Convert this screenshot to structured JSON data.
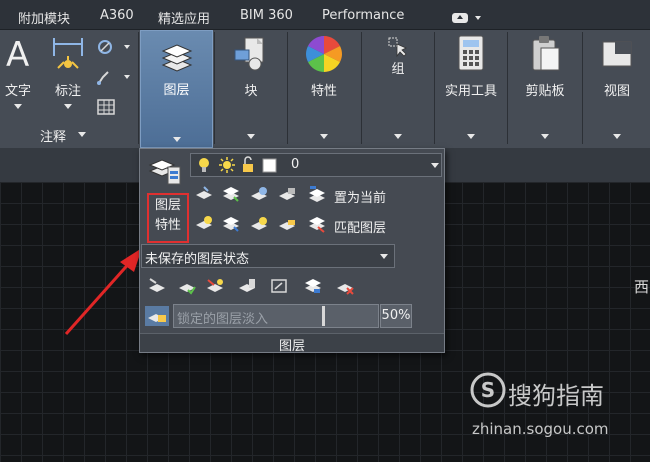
{
  "tabs": [
    "附加模块",
    "A360",
    "精选应用",
    "BIM 360",
    "Performance"
  ],
  "annotation_panel": {
    "text_label": "文字",
    "dim_label": "标注",
    "footer_label": "注释"
  },
  "ribbon_buttons": {
    "layers": "图层",
    "block": "块",
    "properties": "特性",
    "group": "组",
    "utilities": "实用工具",
    "clipboard": "剪贴板",
    "view": "视图"
  },
  "layer_flyout": {
    "current_layer": "0",
    "make_current": "置为当前",
    "match_layer": "匹配图层",
    "layer_props_line1": "图层",
    "layer_props_line2": "特性",
    "layer_state": "未保存的图层状态",
    "lock_fade_label": "锁定的图层淡入",
    "lock_fade_value": "50%",
    "footer_label": "图层"
  },
  "colors": {
    "accent_blue": "#5a7ba3",
    "highlight_red": "#e03030"
  },
  "watermark": {
    "title": "搜狗指南",
    "url": "zhinan.sogou.com"
  },
  "side_text": "西"
}
